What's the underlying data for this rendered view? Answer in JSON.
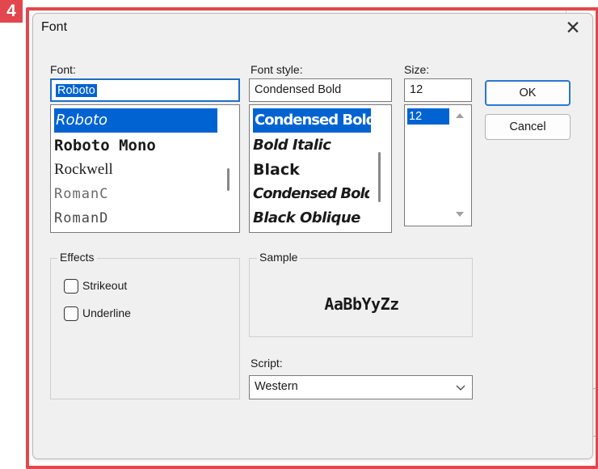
{
  "badge": "4",
  "title": "Font",
  "close_glyph": "✕",
  "font": {
    "label": "Font:",
    "value": "Roboto",
    "items": [
      {
        "label": "Roboto",
        "selected": true
      },
      {
        "label": "Roboto Mono",
        "selected": false
      },
      {
        "label": "Rockwell",
        "selected": false
      },
      {
        "label": "RomanC",
        "selected": false
      },
      {
        "label": "RomanD",
        "selected": false
      }
    ]
  },
  "style": {
    "label": "Font style:",
    "value": "Condensed Bold",
    "items": [
      {
        "label": "Condensed Bold",
        "selected": true
      },
      {
        "label": "Bold Italic",
        "selected": false
      },
      {
        "label": "Black",
        "selected": false
      },
      {
        "label": "Condensed Bold",
        "selected": false
      },
      {
        "label": "Black Oblique",
        "selected": false
      }
    ]
  },
  "size": {
    "label": "Size:",
    "value": "12",
    "items": [
      {
        "label": "12",
        "selected": true
      }
    ]
  },
  "buttons": {
    "ok": "OK",
    "cancel": "Cancel"
  },
  "effects": {
    "legend": "Effects",
    "strikeout": {
      "label": "Strikeout",
      "checked": false
    },
    "underline": {
      "label": "Underline",
      "checked": false
    }
  },
  "sample": {
    "legend": "Sample",
    "text": "AaBbYyZz"
  },
  "script": {
    "label": "Script:",
    "value": "Western"
  },
  "colors": {
    "accent": "#0063d1",
    "frame": "#e2474d"
  }
}
